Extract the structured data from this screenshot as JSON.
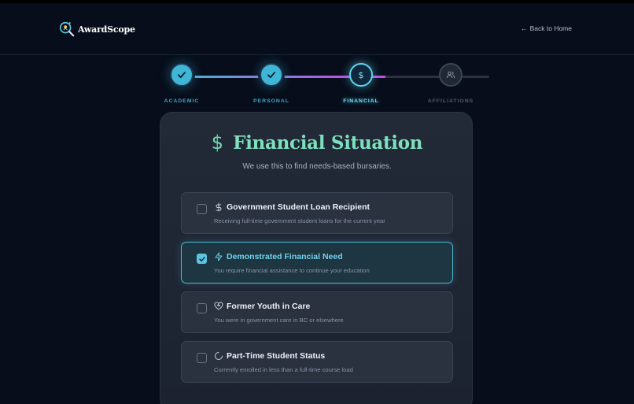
{
  "header": {
    "brand": "AwardScope",
    "back_link": "Back to Home"
  },
  "stepper": {
    "steps": [
      {
        "label": "ACADEMIC",
        "state": "done",
        "icon": "check-icon"
      },
      {
        "label": "PERSONAL",
        "state": "done",
        "icon": "check-icon"
      },
      {
        "label": "FINANCIAL",
        "state": "current",
        "icon": "dollar-icon"
      },
      {
        "label": "AFFILIATIONS",
        "state": "future",
        "icon": "users-icon"
      }
    ]
  },
  "card": {
    "title_symbol": "$",
    "title": "Financial Situation",
    "subtitle": "We use this to find needs-based bursaries.",
    "options": [
      {
        "title": "Government Student Loan Recipient",
        "description": "Receiving full-time government student loans for the current year",
        "icon": "dollar-icon",
        "checked": false
      },
      {
        "title": "Demonstrated Financial Need",
        "description": "You require financial assistance to continue your education",
        "icon": "lightning-icon",
        "checked": true
      },
      {
        "title": "Former Youth in Care",
        "description": "You were in government care in BC or elsewhere",
        "icon": "heart-handshake-icon",
        "checked": false
      },
      {
        "title": "Part-Time Student Status",
        "description": "Currently enrolled in less than a full-time course load",
        "icon": "loader-icon",
        "checked": false
      }
    ]
  },
  "colors": {
    "background": "#070d1a",
    "accent_cyan": "#3fb6d6",
    "accent_purple": "#c04de8",
    "title_green": "#7ee0bf"
  }
}
